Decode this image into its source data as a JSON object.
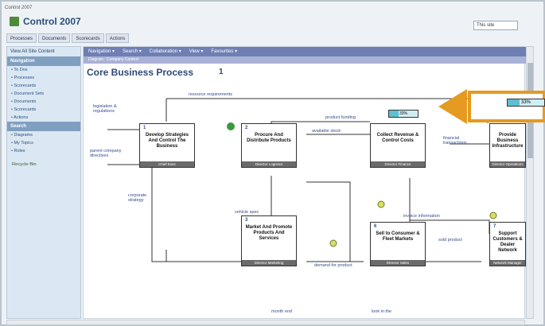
{
  "window": {
    "title": "Control 2007",
    "brand": "Control 2007"
  },
  "site_menu": "This site",
  "tabs": [
    "Processes",
    "Documents",
    "Scorecards",
    "Actions"
  ],
  "leftnav": {
    "top": "View All Site Content",
    "navigation_head": "Navigation",
    "navigation_items": [
      "To Dos",
      "Processes",
      "Scorecards",
      "Document Sets",
      "Documents",
      "Scorecards",
      "Actions"
    ],
    "search_head": "Search",
    "search_items": [
      "Diagrams",
      "My Topics",
      "Roles"
    ],
    "recycle": "Recycle Bin"
  },
  "content_nav": [
    "Navigation",
    "Search",
    "Collaboration",
    "View",
    "Favourites"
  ],
  "sub_bar": "Diagram : Company Context",
  "page": {
    "title": "Core Business Process",
    "number": "1"
  },
  "colors": {
    "accent": "#6f7fb4",
    "callout": "#e59a21",
    "brand_green": "#4f8a3a"
  },
  "diagram": {
    "labels": {
      "resource": "resource requirements",
      "legislation": "legislation & regulations",
      "parent": "parent company directives",
      "corporate": "corporate strategy",
      "product_funding": "product funding",
      "available_stock": "available stock",
      "financial": "financial transactions",
      "invoice": "invoice information",
      "sold_product": "sold product",
      "vehicle_spec": "vehicle spec",
      "demand": "demand for product",
      "month_end": "month end",
      "look_info": "look in the"
    },
    "boxes": [
      {
        "num": "1",
        "title": "Develop Strategies And Control The Business",
        "foot": "Chief Exec"
      },
      {
        "num": "2",
        "title": "Procure And Distribute Products",
        "foot": "Director Logistics"
      },
      {
        "num": "",
        "title": "Collect Revenue & Control Costs",
        "foot": "Director Finance"
      },
      {
        "num": "",
        "title": "Provide Business Infrastructure",
        "foot": "Director Operations"
      },
      {
        "num": "3",
        "title": "Market And Promote Products And Services",
        "foot": "Director Marketing"
      },
      {
        "num": "6",
        "title": "Sell to Consumer & Fleet Markets",
        "foot": "Director Sales"
      },
      {
        "num": "7",
        "title": "Support Customers & Dealer Network",
        "foot": "Network Manager"
      }
    ],
    "progress_pct": "33%",
    "progress_value": 0.33,
    "callout_pct": "33%"
  }
}
